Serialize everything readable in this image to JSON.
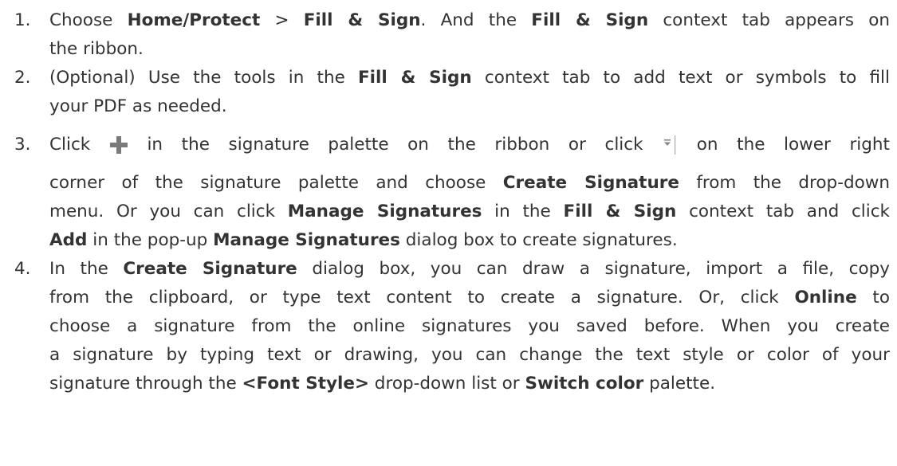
{
  "steps": [
    {
      "number": "1.",
      "lines": [
        [
          "Choose ",
          "Home",
          "/",
          "Protect",
          " > ",
          "Fill & Sign",
          ". And the ",
          "Fill & Sign",
          " context tab appears on"
        ],
        [
          "the ribbon."
        ]
      ]
    },
    {
      "number": "2.",
      "lines": [
        [
          "(Optional) Use the tools in the ",
          "Fill & Sign",
          " context tab to add text or symbols to fill"
        ],
        [
          "your PDF as needed."
        ]
      ]
    },
    {
      "number": "3.",
      "line1_a": "Click",
      "line1_b": "in the signature palette on the ribbon or click",
      "line1_c": "on the lower right",
      "lines": [
        [
          "corner of the signature palette and choose ",
          "Create Signature",
          " from the drop-down"
        ],
        [
          "menu. Or you can click ",
          "Manage Signatures",
          " in the ",
          "Fill & Sign",
          " context tab and click"
        ],
        [
          "Add",
          " in the pop-up ",
          "Manage Signatures",
          " dialog box to create signatures."
        ]
      ]
    },
    {
      "number": "4.",
      "lines": [
        [
          "In the ",
          "Create Signature",
          " dialog box, you can draw a signature, import a file, copy"
        ],
        [
          "from the clipboard, or type text content to create a signature. Or, click ",
          "Online",
          " to"
        ],
        [
          "choose a signature from the online signatures you saved before. When you create"
        ],
        [
          "a signature by typing text or drawing, you can change the text style or color of your"
        ],
        [
          "signature through the ",
          "<Font Style>",
          " drop-down list or ",
          "Switch color",
          " palette."
        ]
      ]
    }
  ],
  "icons": {
    "plus": "plus-icon",
    "dropdown": "dropdown-arrow-icon",
    "plus_color": "#7a7a7a",
    "dropdown_color": "#888888"
  }
}
